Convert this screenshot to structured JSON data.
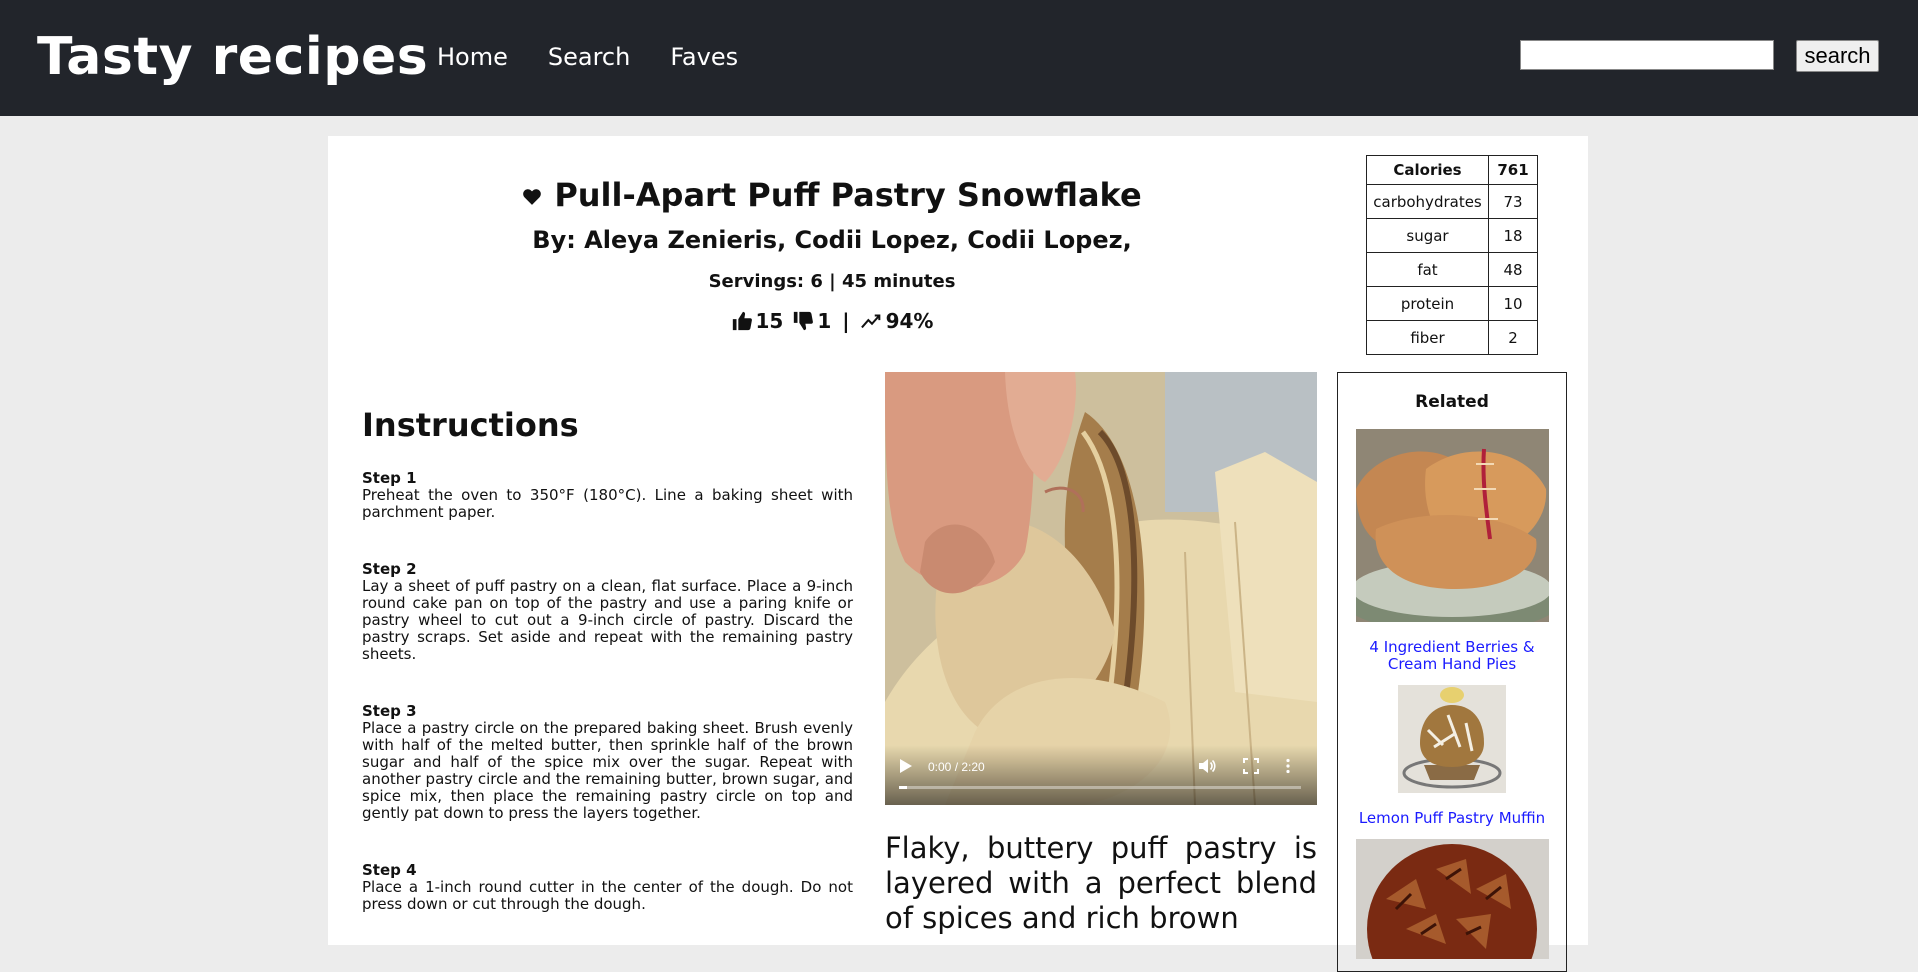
{
  "app": {
    "brand": "Tasty recipes",
    "nav": [
      {
        "label": "Home"
      },
      {
        "label": "Search"
      },
      {
        "label": "Faves"
      }
    ],
    "search": {
      "value": "",
      "button_label": "search"
    }
  },
  "recipe": {
    "title": "Pull-Apart Puff Pastry Snowflake",
    "authors": "By: Aleya Zenieris, Codii Lopez, Codii Lopez,",
    "servings": "Servings: 6 | 45 minutes",
    "likes": "15",
    "dislikes": "1",
    "separator": "|",
    "approval": "94%",
    "heart_icon": "heart-icon",
    "nutrition": {
      "header": {
        "label": "Calories",
        "value": "761"
      },
      "rows": [
        {
          "label": "carbohydrates",
          "value": "73"
        },
        {
          "label": "sugar",
          "value": "18"
        },
        {
          "label": "fat",
          "value": "48"
        },
        {
          "label": "protein",
          "value": "10"
        },
        {
          "label": "fiber",
          "value": "2"
        }
      ]
    },
    "instructions_heading": "Instructions",
    "steps": [
      {
        "label": "Step 1",
        "text": "Preheat the oven to 350°F (180°C). Line a baking sheet with parchment paper."
      },
      {
        "label": "Step 2",
        "text": "Lay a sheet of puff pastry on a clean, flat surface. Place a 9-inch round cake pan on top of the pastry and use a paring knife or pastry wheel to cut out a 9-inch circle of pastry. Discard the pastry scraps. Set aside and repeat with the remaining pastry sheets."
      },
      {
        "label": "Step 3",
        "text": "Place a pastry circle on the prepared baking sheet. Brush evenly with half of the melted butter, then sprinkle half of the brown sugar and half of the spice mix over the sugar. Repeat with another pastry circle and the remaining butter, brown sugar, and spice mix, then place the remaining pastry circle on top and gently pat down to press the layers together."
      },
      {
        "label": "Step 4",
        "text": "Place a 1-inch round cutter in the center of the dough. Do not press down or cut through the dough."
      }
    ],
    "video": {
      "time": "0:00 / 2:20",
      "progress": 0.02
    },
    "description": "Flaky, buttery puff pastry is layered with a perfect blend of spices and rich brown"
  },
  "related": {
    "heading": "Related",
    "items": [
      {
        "title": "4 Ingredient Berries & Cream Hand Pies"
      },
      {
        "title": "Lemon Puff Pastry Muffin"
      },
      {
        "title": ""
      }
    ]
  },
  "colors": {
    "topbar": "#22252b",
    "link": "#1a1aff",
    "page_bg": "#ececec"
  }
}
